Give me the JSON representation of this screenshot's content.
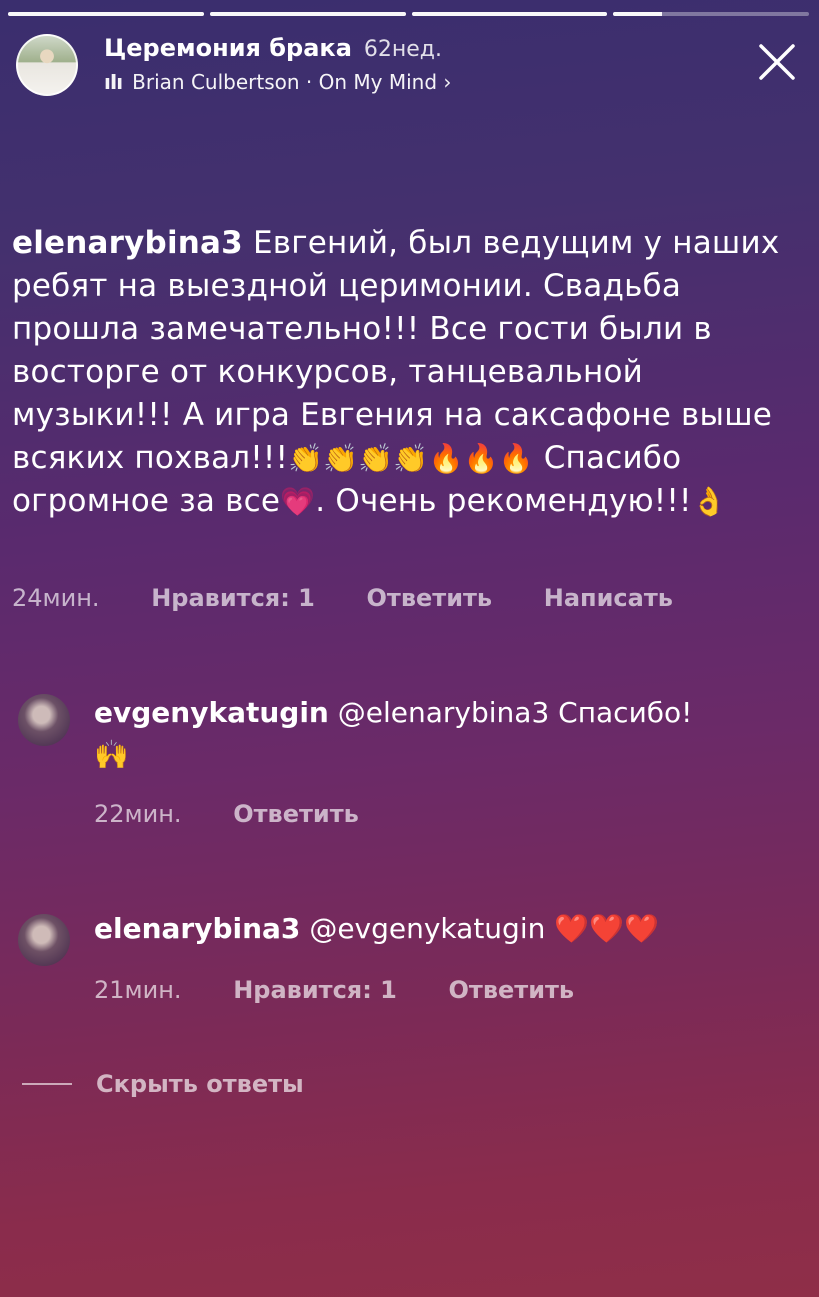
{
  "story": {
    "progress": [
      1,
      1,
      1,
      0.25
    ],
    "title": "Церемония брака",
    "age": "62нед.",
    "music_icon": "audio-bars-icon",
    "music_label": "Brian Culbertson · On My Mind ›"
  },
  "comment": {
    "user": "elenarybina3",
    "text": " Евгений, был ведущим у наших ребят на выездной церимонии. Свадьба прошла замечательно!!! Все гости были в восторге от конкурсов, танцевальной музыки!!! А игра Евгения на саксафоне выше всяких похвал!!!",
    "emojis_1": "👏👏👏👏🔥🔥🔥",
    "text_2": " Спасибо огромное за  все",
    "emoji_heart": "💗",
    "text_3": ". Очень рекомендую!!!",
    "emoji_ok": "👌",
    "time": "24мин.",
    "likes": "Нравится: 1",
    "reply": "Ответить",
    "write": "Написать"
  },
  "replies": [
    {
      "user": "evgenykatugin",
      "mention": " @elenarybina3 Спасибо!",
      "emoji": "🙌",
      "time": "22мин.",
      "reply": "Ответить"
    },
    {
      "user": "elenarybina3",
      "mention": " @evgenykatugin ",
      "emoji": "❤️❤️❤️",
      "time": "21мин.",
      "likes": "Нравится: 1",
      "reply": "Ответить"
    }
  ],
  "hide_replies": "Скрыть ответы"
}
